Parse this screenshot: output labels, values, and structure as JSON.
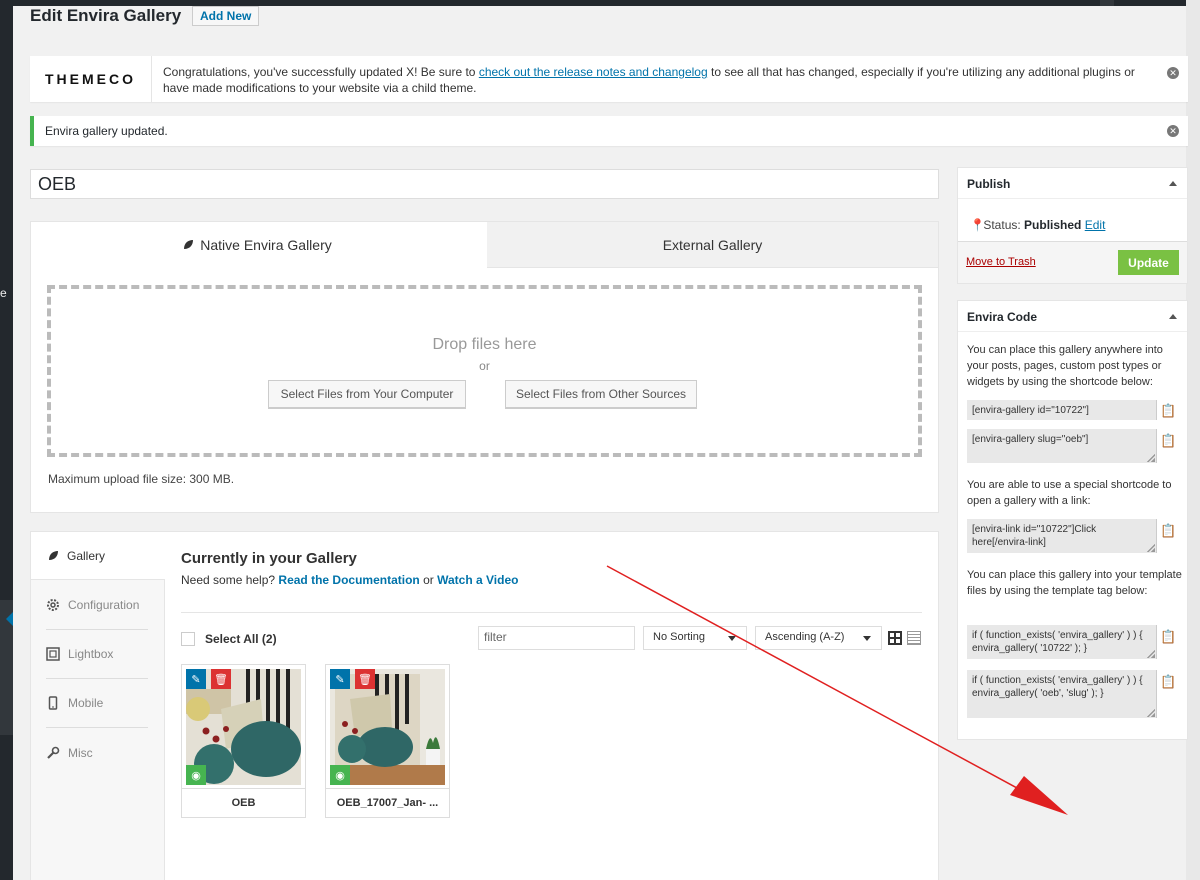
{
  "page": {
    "title": "Edit Envira Gallery",
    "add_new": "Add New",
    "menu_letter": "e"
  },
  "notices": {
    "themeco": {
      "logo": "THEMECO",
      "text_before": "Congratulations, you've successfully updated X! Be sure to ",
      "link": "check out the release notes and changelog",
      "text_after": " to see all that has changed, especially if you're utilizing any additional plugins or have made modifications to your website via a child theme."
    },
    "updated": "Envira gallery updated."
  },
  "gallery_title": "OEB",
  "upload": {
    "tabs": [
      "Native Envira Gallery",
      "External Gallery"
    ],
    "drop_text": "Drop files here",
    "or": "or",
    "btn_computer": "Select Files from Your Computer",
    "btn_other": "Select Files from Other Sources",
    "max_size": "Maximum upload file size: 300 MB."
  },
  "gallery": {
    "side_items": [
      "Gallery",
      "Configuration",
      "Lightbox",
      "Mobile",
      "Misc"
    ],
    "title": "Currently in your Gallery",
    "help_prefix": "Need some help? ",
    "help_doc": "Read the Documentation",
    "help_or": " or ",
    "help_video": "Watch a Video",
    "select_all": "Select All (2)",
    "filter_placeholder": "filter",
    "sort": "No Sorting",
    "order": "Ascending (A-Z)",
    "items": [
      {
        "caption": "OEB"
      },
      {
        "caption": "OEB_17007_Jan- ..."
      }
    ]
  },
  "publish": {
    "title": "Publish",
    "status_label": "Status: ",
    "status_value": "Published",
    "edit": "Edit",
    "trash": "Move to Trash",
    "update": "Update"
  },
  "envira_code": {
    "title": "Envira Code",
    "text1": "You can place this gallery anywhere into your posts, pages, custom post types or widgets by using the shortcode below:",
    "code1": "[envira-gallery id=\"10722\"]",
    "code2": "[envira-gallery slug=\"oeb\"]",
    "text2": "You are able to use a special shortcode to open a gallery with a link:",
    "code3": "[envira-link id=\"10722\"]Click here[/envira-link]",
    "text3": "You can place this gallery into your template files by using the template tag below:",
    "code4": "if ( function_exists( 'envira_gallery' ) ) { envira_gallery( '10722' ); }",
    "code5": "if ( function_exists( 'envira_gallery' ) ) { envira_gallery( 'oeb', 'slug' ); }"
  },
  "colors": {
    "accent": "#0073aa",
    "update_button": "#7ac143",
    "success_border": "#46b450",
    "delete": "#dc3232",
    "annotation_arrow": "#e02020"
  },
  "icons": [
    "leaf-icon",
    "gear-icon",
    "lightbox-icon",
    "mobile-icon",
    "wrench-icon",
    "pin-icon",
    "clipboard-icon",
    "pencil-icon",
    "trash-icon",
    "eye-icon",
    "grid-view-icon",
    "list-view-icon",
    "dismiss-icon"
  ]
}
